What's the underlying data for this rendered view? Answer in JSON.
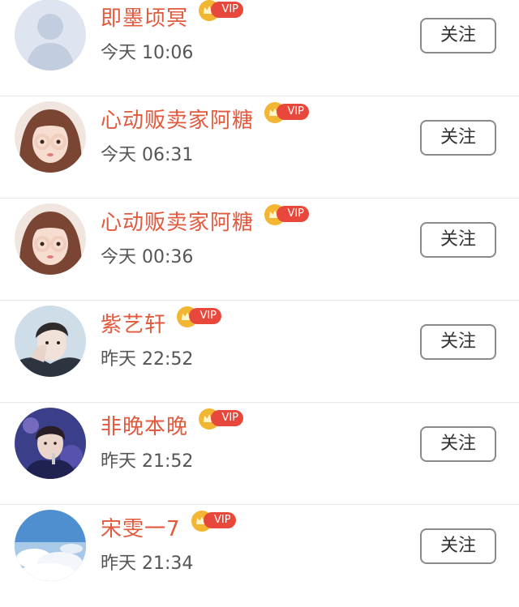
{
  "follow_list": [
    {
      "name": "即墨顷冥",
      "vip": "VIP",
      "time": "今天 10:06",
      "button": "关注",
      "avatar": "default-avatar"
    },
    {
      "name": "心动贩卖家阿糖",
      "vip": "VIP",
      "time": "今天 06:31",
      "button": "关注",
      "avatar": "girl-photo-avatar"
    },
    {
      "name": "心动贩卖家阿糖",
      "vip": "VIP",
      "time": "今天 00:36",
      "button": "关注",
      "avatar": "girl-photo-avatar"
    },
    {
      "name": "紫艺轩",
      "vip": "VIP",
      "time": "昨天 22:52",
      "button": "关注",
      "avatar": "boy-photo-avatar"
    },
    {
      "name": "非晚本晚",
      "vip": "VIP",
      "time": "昨天 21:52",
      "button": "关注",
      "avatar": "singer-photo-avatar"
    },
    {
      "name": "宋雯一7",
      "vip": "VIP",
      "time": "昨天 21:34",
      "button": "关注",
      "avatar": "sky-clouds-avatar"
    }
  ],
  "colors": {
    "name": "#e25a3d",
    "vip_badge": "#e8483b",
    "crown": "#f2b632",
    "time": "#555555",
    "button_border": "#8a8a8a"
  }
}
